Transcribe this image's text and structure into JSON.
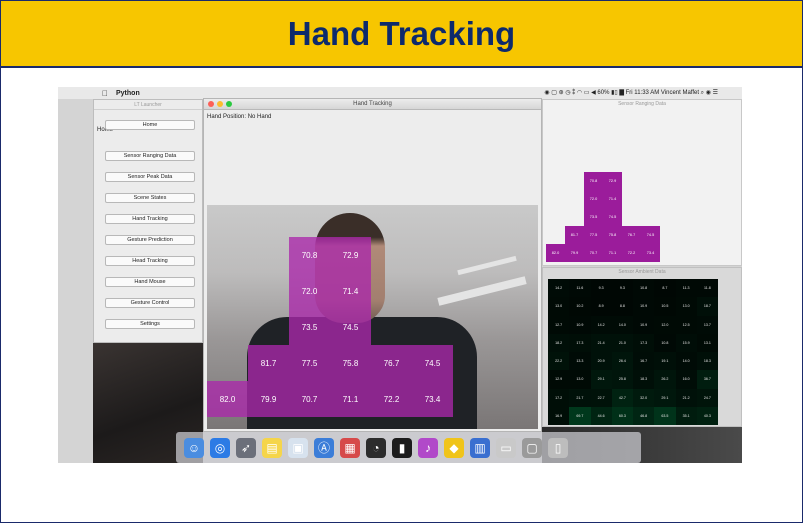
{
  "slide": {
    "title": "Hand Tracking"
  },
  "menubar": {
    "apple_glyph": "",
    "app_name": "Python",
    "status_text": "◉ ▢ ⊛ ◷ ⁑ ◠ ▭ ◀ 60% ▮▯ ▇ Fri 11:33 AM  Vincent Maffet  ⌕ ◉ ☰"
  },
  "launcher": {
    "window_title": "LT Launcher",
    "current_label": "Home",
    "buttons": [
      "Home",
      "Sensor Ranging Data",
      "Sensor Peak Data",
      "Scene States",
      "Hand Tracking",
      "Gesture Prediction",
      "Head Tracking",
      "Hand Mouse",
      "Gesture Control",
      "Settings"
    ]
  },
  "tracker": {
    "window_title": "Hand Tracking",
    "hand_position_text": "Hand Position: No Hand",
    "grid": [
      [
        "70.8",
        "72.9"
      ],
      [
        "72.0",
        "71.4"
      ],
      [
        "73.5",
        "74.5"
      ],
      [
        "81.7",
        "77.5",
        "75.8",
        "76.7",
        "74.5"
      ],
      [
        "82.0",
        "79.9",
        "70.7",
        "71.1",
        "72.2",
        "73.4"
      ]
    ]
  },
  "peak_window": {
    "title": "Sensor Ranging Data",
    "grid": [
      [
        "70.8",
        "72.9"
      ],
      [
        "72.0",
        "71.4"
      ],
      [
        "73.5",
        "74.5"
      ],
      [
        "81.7",
        "77.5",
        "75.8",
        "76.7",
        "74.5"
      ],
      [
        "82.0",
        "79.9",
        "70.7",
        "71.1",
        "72.2",
        "73.4"
      ]
    ]
  },
  "ambient_window": {
    "title": "Sensor Ambient Data",
    "rows": [
      [
        "14.2",
        "11.6",
        "9.3",
        "9.3",
        "10.8",
        "8.7",
        "11.3",
        "11.8"
      ],
      [
        "13.0",
        "10.2",
        "8.9",
        "8.8",
        "10.9",
        "10.5",
        "13.0",
        "18.7"
      ],
      [
        "12.7",
        "10.9",
        "14.2",
        "14.0",
        "10.9",
        "12.0",
        "12.5",
        "13.7"
      ],
      [
        "18.2",
        "17.3",
        "21.4",
        "21.0",
        "17.3",
        "10.8",
        "15.9",
        "13.1"
      ],
      [
        "22.2",
        "13.3",
        "20.9",
        "26.4",
        "16.7",
        "19.1",
        "14.0",
        "18.3"
      ],
      [
        "12.9",
        "13.0",
        "29.1",
        "25.8",
        "18.3",
        "26.2",
        "16.0",
        "36.7"
      ],
      [
        "17.2",
        "21.7",
        "22.7",
        "42.7",
        "32.0",
        "29.1",
        "21.2",
        "24.7"
      ],
      [
        "16.9",
        "69.7",
        "44.6",
        "60.3",
        "46.8",
        "63.5",
        "35.1",
        "40.3"
      ]
    ]
  },
  "dock": {
    "icons": [
      "finder-icon",
      "safari-icon",
      "launchpad-icon",
      "notes-icon",
      "preview-icon",
      "appstore-icon",
      "calendar-icon",
      "activity-icon",
      "terminal-icon",
      "itunes-icon",
      "python-icon",
      "files-icon",
      "monitor-icon",
      "window-icon",
      "trash-icon"
    ]
  }
}
